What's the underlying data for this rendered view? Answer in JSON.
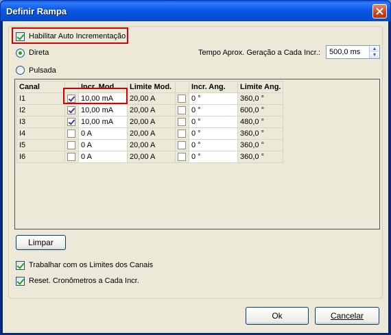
{
  "window": {
    "title": "Definir Rampa"
  },
  "options": {
    "habilitar_label": "Habilitar Auto Incrementação",
    "habilitar_checked": true,
    "direta_label": "Direta",
    "pulsada_label": "Pulsada",
    "selected_mode": "Direta",
    "tempo_label": "Tempo Aprox. Geração a Cada Incr.:",
    "tempo_value": "500,0 ms"
  },
  "grid": {
    "headers": [
      "Canal",
      "",
      "Incr. Mod.",
      "Limite Mod.",
      "",
      "Incr. Ang.",
      "Limite Ang."
    ],
    "rows": [
      {
        "canal": "I1",
        "mod_checked": true,
        "incr_mod": "10,00 mA",
        "limite_mod": "20,00 A",
        "ang_checked": false,
        "incr_ang": "0 °",
        "limite_ang": "360,0 °"
      },
      {
        "canal": "I2",
        "mod_checked": true,
        "incr_mod": "10,00 mA",
        "limite_mod": "20,00 A",
        "ang_checked": false,
        "incr_ang": "0 °",
        "limite_ang": "600,0 °"
      },
      {
        "canal": "I3",
        "mod_checked": true,
        "incr_mod": "10,00 mA",
        "limite_mod": "20,00 A",
        "ang_checked": false,
        "incr_ang": "0 °",
        "limite_ang": "480,0 °"
      },
      {
        "canal": "I4",
        "mod_checked": false,
        "incr_mod": "0 A",
        "limite_mod": "20,00 A",
        "ang_checked": false,
        "incr_ang": "0 °",
        "limite_ang": "360,0 °"
      },
      {
        "canal": "I5",
        "mod_checked": false,
        "incr_mod": "0 A",
        "limite_mod": "20,00 A",
        "ang_checked": false,
        "incr_ang": "0 °",
        "limite_ang": "360,0 °"
      },
      {
        "canal": "I6",
        "mod_checked": false,
        "incr_mod": "0 A",
        "limite_mod": "20,00 A",
        "ang_checked": false,
        "incr_ang": "0 °",
        "limite_ang": "360,0 °"
      }
    ]
  },
  "buttons": {
    "limpar": "Limpar",
    "ok": "Ok",
    "cancelar": "Cancelar"
  },
  "bottom_options": {
    "trabalhar_label": "Trabalhar com os Limites dos Canais",
    "trabalhar_checked": true,
    "reset_label": "Reset. Cronômetros a Cada Incr.",
    "reset_checked": true
  },
  "colors": {
    "highlight": "#d60000",
    "titlebar": "#0a57e4",
    "check": "#21a121"
  },
  "icons": {
    "close": "close-icon",
    "spin_up": "chevron-up-icon",
    "spin_down": "chevron-down-icon"
  }
}
